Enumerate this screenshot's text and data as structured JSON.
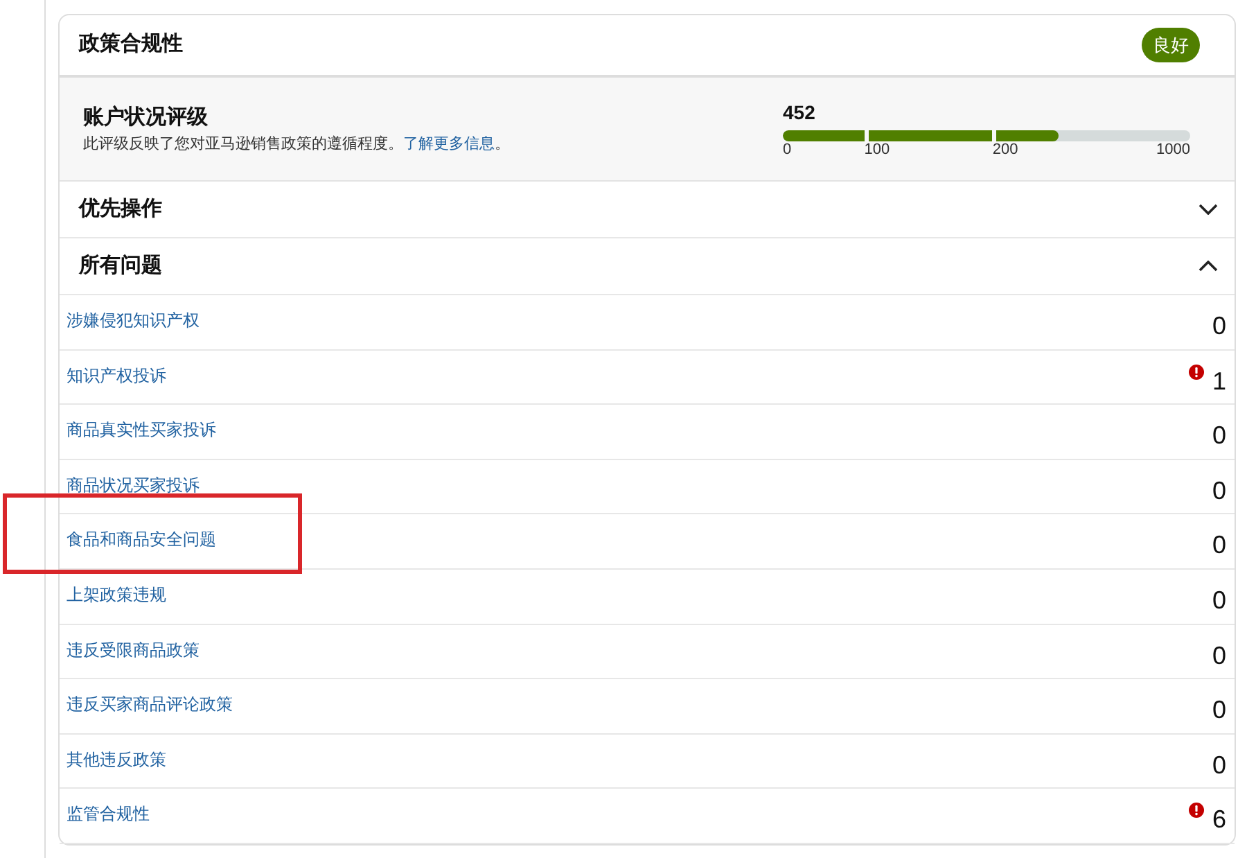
{
  "card": {
    "title": "政策合规性",
    "status_badge": "良好"
  },
  "rating": {
    "title": "账户状况评级",
    "description": "此评级反映了您对亚马逊销售政策的遵循程度。",
    "link": "了解更多信息",
    "after_link": "。",
    "score": "452",
    "level": 0.676,
    "ticks": [
      "0",
      "100",
      "200",
      "1000"
    ]
  },
  "sections": [
    {
      "title": "优先操作",
      "expanded": false
    },
    {
      "title": "所有问题",
      "expanded": true
    }
  ],
  "issues": [
    {
      "label": "涉嫌侵犯知识产权",
      "count": "0",
      "alert": false,
      "highlighted": false
    },
    {
      "label": "知识产权投诉",
      "count": "1",
      "alert": true,
      "highlighted": false
    },
    {
      "label": "商品真实性买家投诉",
      "count": "0",
      "alert": false,
      "highlighted": false
    },
    {
      "label": "商品状况买家投诉",
      "count": "0",
      "alert": false,
      "highlighted": false
    },
    {
      "label": "食品和商品安全问题",
      "count": "0",
      "alert": false,
      "highlighted": true
    },
    {
      "label": "上架政策违规",
      "count": "0",
      "alert": false,
      "highlighted": false
    },
    {
      "label": "违反受限商品政策",
      "count": "0",
      "alert": false,
      "highlighted": false
    },
    {
      "label": "违反买家商品评论政策",
      "count": "0",
      "alert": false,
      "highlighted": false
    },
    {
      "label": "其他违反政策",
      "count": "0",
      "alert": false,
      "highlighted": false
    },
    {
      "label": "监管合规性",
      "count": "6",
      "alert": true,
      "highlighted": false
    }
  ]
}
